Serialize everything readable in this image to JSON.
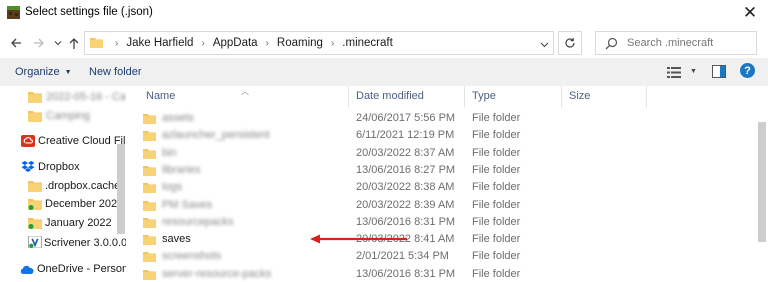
{
  "window": {
    "title": "Select settings file (.json)",
    "close_glyph": "✕"
  },
  "address": {
    "crumbs": [
      "Jake Harfield",
      "AppData",
      "Roaming",
      ".minecraft"
    ],
    "separator": "›"
  },
  "search": {
    "placeholder": "Search .minecraft"
  },
  "toolbar": {
    "organize_label": "Organize",
    "new_folder_label": "New folder",
    "help_glyph": "?"
  },
  "columns": {
    "name": "Name",
    "date": "Date modified",
    "type": "Type",
    "size": "Size"
  },
  "nav": {
    "items": [
      {
        "label": "2022-05-16 - Ca",
        "icon": "folder-icon",
        "blurred": true
      },
      {
        "label": "Camping",
        "icon": "folder-icon",
        "blurred": true
      },
      {
        "label": "Creative Cloud Fil",
        "icon": "creative-cloud-icon",
        "blurred": false
      },
      {
        "label": "Dropbox",
        "icon": "dropbox-icon",
        "blurred": false
      },
      {
        "label": ".dropbox.cache",
        "icon": "folder-icon",
        "blurred": false
      },
      {
        "label": "December 2021",
        "icon": "folder-sync-icon",
        "blurred": false
      },
      {
        "label": "January 2022",
        "icon": "folder-sync-icon",
        "blurred": false
      },
      {
        "label": "Scrivener 3.0.0.0",
        "icon": "scrivener-icon",
        "blurred": false
      },
      {
        "label": "OneDrive - Person",
        "icon": "onedrive-icon",
        "blurred": false
      }
    ]
  },
  "files": [
    {
      "name": "assets",
      "date": "24/06/2017 5:56 PM",
      "type": "File folder",
      "blurred": true
    },
    {
      "name": "azlauncher_persistent",
      "date": "6/11/2021 12:19 PM",
      "type": "File folder",
      "blurred": true
    },
    {
      "name": "bin",
      "date": "20/03/2022 8:37 AM",
      "type": "File folder",
      "blurred": true
    },
    {
      "name": "libraries",
      "date": "13/06/2016 8:27 PM",
      "type": "File folder",
      "blurred": true
    },
    {
      "name": "logs",
      "date": "20/03/2022 8:38 AM",
      "type": "File folder",
      "blurred": true
    },
    {
      "name": "PM Saves",
      "date": "20/03/2022 8:39 AM",
      "type": "File folder",
      "blurred": true
    },
    {
      "name": "resourcepacks",
      "date": "13/06/2016 8:31 PM",
      "type": "File folder",
      "blurred": true
    },
    {
      "name": "saves",
      "date": "20/03/2022 8:41 AM",
      "type": "File folder",
      "blurred": false
    },
    {
      "name": "screenshots",
      "date": "2/01/2021 5:34 PM",
      "type": "File folder",
      "blurred": true
    },
    {
      "name": "server-resource-packs",
      "date": "13/06/2016 8:31 PM",
      "type": "File folder",
      "blurred": true
    }
  ],
  "colors": {
    "accent": "#1a78c2",
    "arrow": "#d9221c",
    "folder": "#f2c55c"
  }
}
